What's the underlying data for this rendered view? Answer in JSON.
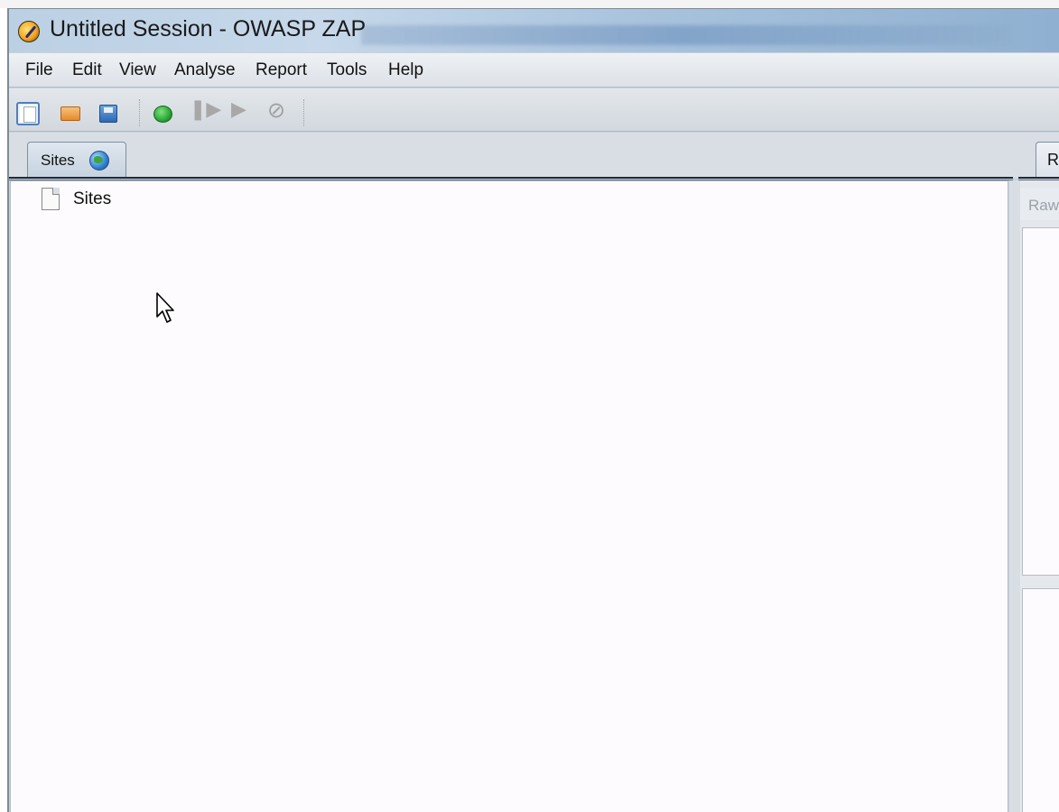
{
  "window": {
    "title": "Untitled Session - OWASP ZAP"
  },
  "menu": {
    "items": [
      "File",
      "Edit",
      "View",
      "Analyse",
      "Report",
      "Tools",
      "Help"
    ]
  },
  "toolbar": {
    "buttons": [
      "new-session-icon",
      "open-session-icon",
      "save-session-icon",
      "start-icon",
      "step-icon",
      "play-icon",
      "stop-icon"
    ]
  },
  "tabs": {
    "left": "Sites",
    "right": "R"
  },
  "tree": {
    "root_label": "Sites"
  },
  "right_pane": {
    "view_label": "Raw"
  }
}
